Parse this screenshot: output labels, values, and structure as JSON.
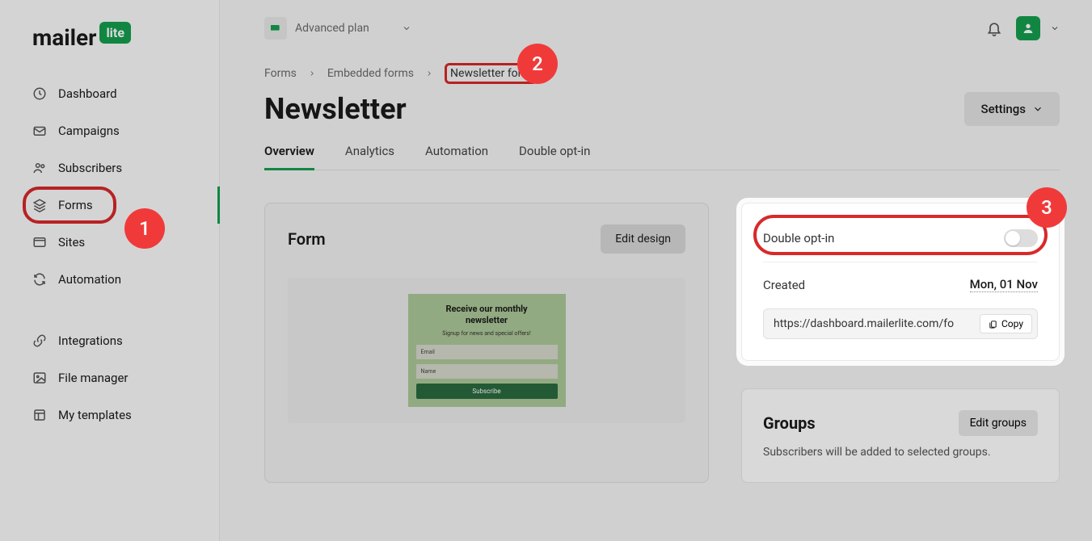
{
  "logo": {
    "text": "mailer",
    "badge": "lite"
  },
  "sidebar": {
    "items": [
      {
        "label": "Dashboard"
      },
      {
        "label": "Campaigns"
      },
      {
        "label": "Subscribers"
      },
      {
        "label": "Forms"
      },
      {
        "label": "Sites"
      },
      {
        "label": "Automation"
      },
      {
        "label": "Integrations"
      },
      {
        "label": "File manager"
      },
      {
        "label": "My templates"
      }
    ]
  },
  "plan": {
    "label": "Advanced plan"
  },
  "breadcrumbs": {
    "a": "Forms",
    "b": "Embedded forms",
    "c": "Newsletter form"
  },
  "page": {
    "title": "Newsletter",
    "settings": "Settings"
  },
  "tabs": [
    "Overview",
    "Analytics",
    "Automation",
    "Double opt-in"
  ],
  "formCard": {
    "title": "Form",
    "edit": "Edit design",
    "preview": {
      "title1": "Receive our monthly",
      "title2": "newsletter",
      "sub": "Signup for news and special offers!",
      "email": "Email",
      "name": "Name",
      "button": "Subscribe"
    }
  },
  "info": {
    "optInLabel": "Double opt-in",
    "createdLabel": "Created",
    "createdValue": "Mon, 01 Nov",
    "url": "https://dashboard.mailerlite.com/fo",
    "copy": "Copy"
  },
  "groups": {
    "title": "Groups",
    "edit": "Edit groups",
    "desc": "Subscribers will be added to selected groups."
  },
  "markers": {
    "m1": "1",
    "m2": "2",
    "m3": "3"
  }
}
